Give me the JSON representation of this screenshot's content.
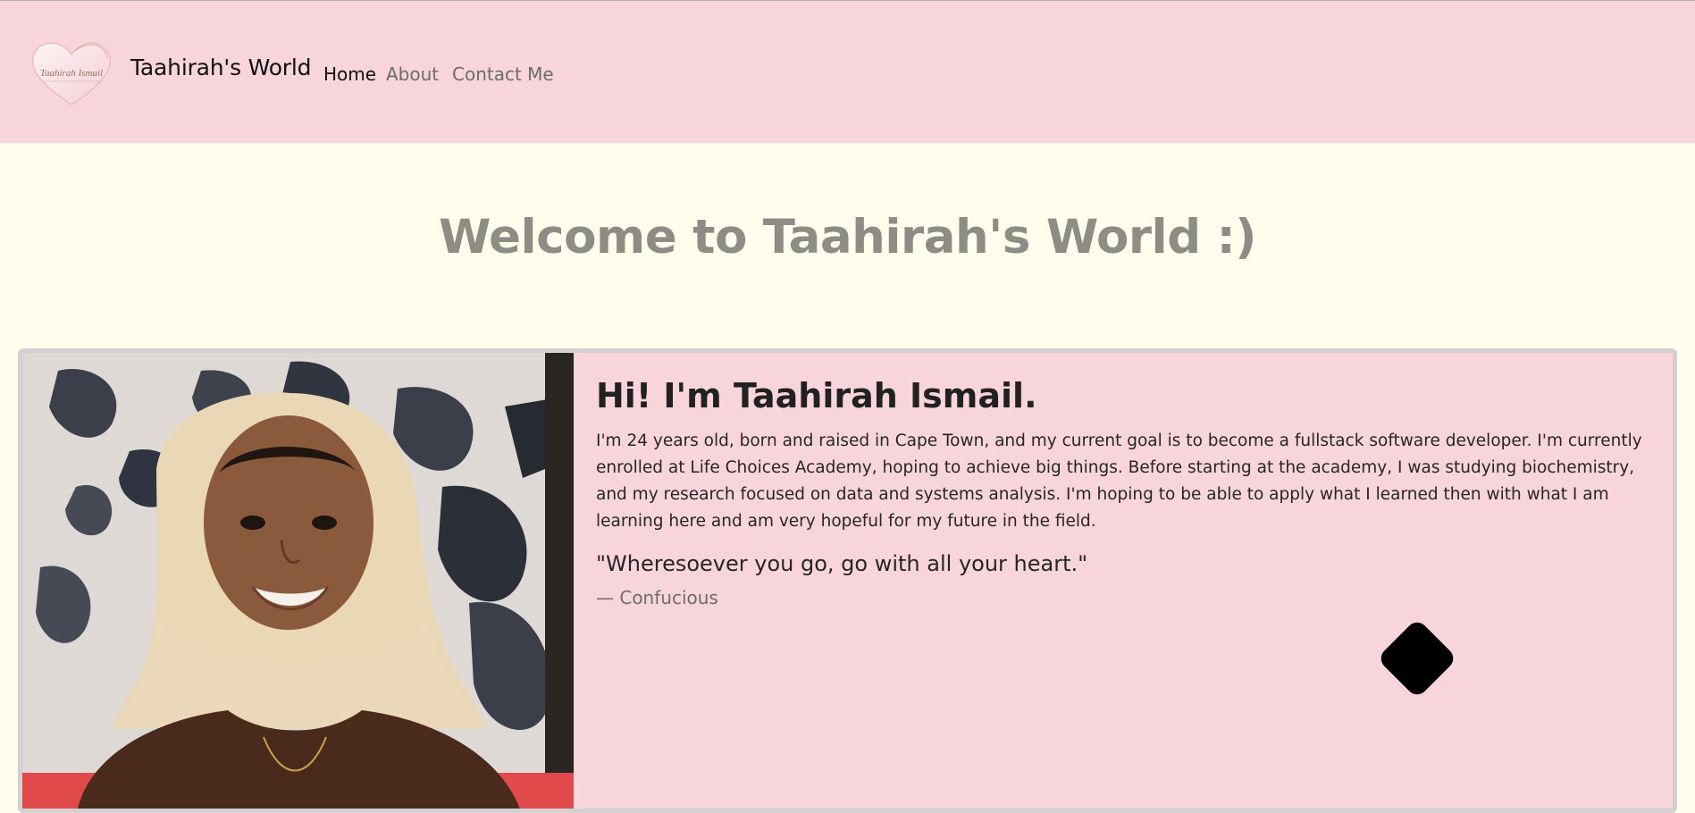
{
  "navbar": {
    "logo_text": "Taahirah Ismail",
    "brand": "Taahirah's World",
    "links": [
      {
        "label": "Home",
        "active": true
      },
      {
        "label": "About",
        "active": false
      },
      {
        "label": "Contact Me",
        "active": false
      }
    ]
  },
  "hero": {
    "title": "Welcome to Taahirah's World :)"
  },
  "card": {
    "title": "Hi! I'm Taahirah Ismail.",
    "text": "I'm 24 years old, born and raised in Cape Town, and my current goal is to become a fullstack software developer. I'm currently enrolled at Life Choices Academy, hoping to achieve big things. Before starting at the academy, I was studying biochemistry, and my research focused on data and systems analysis. I'm hoping to be able to apply what I learned then with what I am learning here and am very hopeful for my future in the field.",
    "quote": "\"Wheresoever you go, go with all your heart.\"",
    "quote_author": "— Confucious"
  },
  "colors": {
    "navbar_bg": "#f8d5db",
    "page_bg": "#fffdec",
    "card_bg": "#f8d5db",
    "hero_text": "#8d8d86"
  }
}
